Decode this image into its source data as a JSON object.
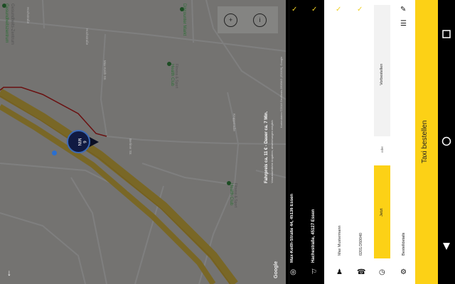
{
  "map": {
    "poi": {
      "gesundheit_top": "Gesundheitszentrum",
      "gesundheit_top2": "Gesundheits-Zentrum",
      "discount": "Discounter Markt",
      "health_club_1": "Health Club",
      "health_club_1_sub": "Fitness & Sport",
      "health_club_2": "Health Club",
      "health_club_2_sub": "Fitness & Sport"
    },
    "streets": {
      "s1": "Hochstraße",
      "s2": "Hochstraße",
      "s3": "Max-Keith-Str.",
      "s4": "Berliner Str.",
      "s5": "Kruppstraße"
    },
    "fare_text": "Fahrpreis ca. 11 € - Dauer ca. 7 Min.",
    "fare_sub": "Voraussichtliche Angaben, abweichungen möglich",
    "copyright": "Kartendaten ©2018 GeoBasis-DE/BKG (©2009), Google",
    "google_logo": "Google",
    "eta_value": "6",
    "eta_unit": "MIN",
    "zoom_in_icon": "zoom-in-icon",
    "info_icon": "info-icon",
    "download_icon": "arrow-down-icon"
  },
  "route": {
    "pickup": "Max-Keith-Straße 44, 45136 Essen",
    "destination": "Hachestraße, 45127 Essen"
  },
  "form": {
    "name": "Max Mustermann",
    "phone": "0201/260040",
    "time_now": "Jetzt",
    "time_or": "oder",
    "time_pre": "Vorbestellen",
    "details": "Bestelldetails"
  },
  "order_button": "Taxi bestellen",
  "colors": {
    "accent": "#fcd116",
    "route": "#d42020"
  }
}
